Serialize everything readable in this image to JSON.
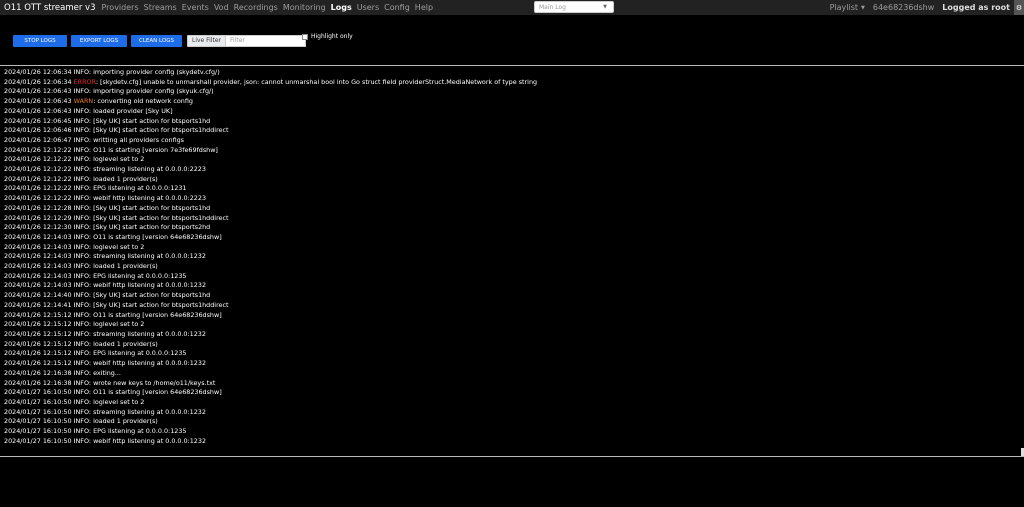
{
  "app": {
    "title": "O11 OTT streamer v3"
  },
  "nav": {
    "items": [
      {
        "label": "Providers",
        "active": false
      },
      {
        "label": "Streams",
        "active": false
      },
      {
        "label": "Events",
        "active": false
      },
      {
        "label": "Vod",
        "active": false
      },
      {
        "label": "Recordings",
        "active": false
      },
      {
        "label": "Monitoring",
        "active": false
      },
      {
        "label": "Logs",
        "active": true
      },
      {
        "label": "Users",
        "active": false
      },
      {
        "label": "Config",
        "active": false
      },
      {
        "label": "Help",
        "active": false
      }
    ],
    "log_select": "Main Log",
    "playlist": "Playlist",
    "user_id": "64e68236dshw",
    "logged_as": "Logged as root"
  },
  "toolbar": {
    "stop_label": "STOP LOGS",
    "export_label": "EXPORT LOGS",
    "clean_label": "CLEAN LOGS",
    "filter_addon": "Live Filter",
    "filter_placeholder": "Filter",
    "highlight_label": "Highlight only"
  },
  "colors": {
    "button": "#1e6ce8",
    "navbar": "#222222",
    "error": "#e0302a",
    "warn": "#e07b20"
  },
  "logs": [
    {
      "ts": "2024/01/26 12:06:34",
      "level": "INFO",
      "msg": "importing provider config (skydetv.cfg/)"
    },
    {
      "ts": "2024/01/26 12:06:34",
      "level": "ERROR",
      "msg": "[skydetv.cfg] unable to unmarshall provider, json: cannot unmarshal bool into Go struct field providerStruct.MediaNetwork of type string"
    },
    {
      "ts": "2024/01/26 12:06:43",
      "level": "INFO",
      "msg": "importing provider config (skyuk.cfg/)"
    },
    {
      "ts": "2024/01/26 12:06:43",
      "level": "WARN",
      "msg": "converting old network config"
    },
    {
      "ts": "2024/01/26 12:06:43",
      "level": "INFO",
      "msg": "loaded provider [Sky UK]"
    },
    {
      "ts": "2024/01/26 12:06:45",
      "level": "INFO",
      "msg": "[Sky UK] start action for btsports1hd"
    },
    {
      "ts": "2024/01/26 12:06:46",
      "level": "INFO",
      "msg": "[Sky UK] start action for btsports1hddirect"
    },
    {
      "ts": "2024/01/26 12:06:47",
      "level": "INFO",
      "msg": "writting all providers configs"
    },
    {
      "ts": "2024/01/26 12:12:22",
      "level": "INFO",
      "msg": "O11 is starting [version 7e3fe69fdshw]"
    },
    {
      "ts": "2024/01/26 12:12:22",
      "level": "INFO",
      "msg": "loglevel set to 2"
    },
    {
      "ts": "2024/01/26 12:12:22",
      "level": "INFO",
      "msg": "streaming listening at 0.0.0.0:2223"
    },
    {
      "ts": "2024/01/26 12:12:22",
      "level": "INFO",
      "msg": "loaded 1 provider(s)"
    },
    {
      "ts": "2024/01/26 12:12:22",
      "level": "INFO",
      "msg": "EPG listening at 0.0.0.0:1231"
    },
    {
      "ts": "2024/01/26 12:12:22",
      "level": "INFO",
      "msg": "webif http listening at 0.0.0.0:2223"
    },
    {
      "ts": "2024/01/26 12:12:28",
      "level": "INFO",
      "msg": "[Sky UK] start action for btsports1hd"
    },
    {
      "ts": "2024/01/26 12:12:29",
      "level": "INFO",
      "msg": "[Sky UK] start action for btsports1hddirect"
    },
    {
      "ts": "2024/01/26 12:12:30",
      "level": "INFO",
      "msg": "[Sky UK] start action for btsports2hd"
    },
    {
      "ts": "2024/01/26 12:14:03",
      "level": "INFO",
      "msg": "O11 is starting [version 64e68236dshw]"
    },
    {
      "ts": "2024/01/26 12:14:03",
      "level": "INFO",
      "msg": "loglevel set to 2"
    },
    {
      "ts": "2024/01/26 12:14:03",
      "level": "INFO",
      "msg": "streaming listening at 0.0.0.0:1232"
    },
    {
      "ts": "2024/01/26 12:14:03",
      "level": "INFO",
      "msg": "loaded 1 provider(s)"
    },
    {
      "ts": "2024/01/26 12:14:03",
      "level": "INFO",
      "msg": "EPG listening at 0.0.0.0:1235"
    },
    {
      "ts": "2024/01/26 12:14:03",
      "level": "INFO",
      "msg": "webif http listening at 0.0.0.0:1232"
    },
    {
      "ts": "2024/01/26 12:14:40",
      "level": "INFO",
      "msg": "[Sky UK] start action for btsports1hd"
    },
    {
      "ts": "2024/01/26 12:14:41",
      "level": "INFO",
      "msg": "[Sky UK] start action for btsports1hddirect"
    },
    {
      "ts": "2024/01/26 12:15:12",
      "level": "INFO",
      "msg": "O11 is starting [version 64e68236dshw]"
    },
    {
      "ts": "2024/01/26 12:15:12",
      "level": "INFO",
      "msg": "loglevel set to 2"
    },
    {
      "ts": "2024/01/26 12:15:12",
      "level": "INFO",
      "msg": "streaming listening at 0.0.0.0:1232"
    },
    {
      "ts": "2024/01/26 12:15:12",
      "level": "INFO",
      "msg": "loaded 1 provider(s)"
    },
    {
      "ts": "2024/01/26 12:15:12",
      "level": "INFO",
      "msg": "EPG listening at 0.0.0.0:1235"
    },
    {
      "ts": "2024/01/26 12:15:12",
      "level": "INFO",
      "msg": "webif http listening at 0.0.0.0:1232"
    },
    {
      "ts": "2024/01/26 12:16:38",
      "level": "INFO",
      "msg": "exiting..."
    },
    {
      "ts": "2024/01/26 12:16:38",
      "level": "INFO",
      "msg": "wrote new keys to /home/o11/keys.txt"
    },
    {
      "ts": "2024/01/27 16:10:50",
      "level": "INFO",
      "msg": "O11 is starting [version 64e68236dshw]"
    },
    {
      "ts": "2024/01/27 16:10:50",
      "level": "INFO",
      "msg": "loglevel set to 2"
    },
    {
      "ts": "2024/01/27 16:10:50",
      "level": "INFO",
      "msg": "streaming listening at 0.0.0.0:1232"
    },
    {
      "ts": "2024/01/27 16:10:50",
      "level": "INFO",
      "msg": "loaded 1 provider(s)"
    },
    {
      "ts": "2024/01/27 16:10:50",
      "level": "INFO",
      "msg": "EPG listening at 0.0.0.0:1235"
    },
    {
      "ts": "2024/01/27 16:10:50",
      "level": "INFO",
      "msg": "webif http listening at 0.0.0.0:1232"
    }
  ]
}
